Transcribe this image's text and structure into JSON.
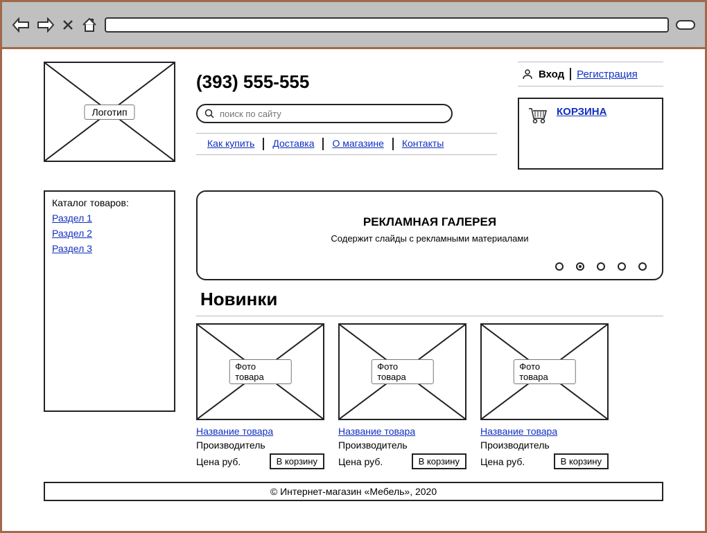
{
  "header": {
    "logo_label": "Логотип",
    "phone": "(393) 555-555",
    "search_placeholder": "поиск по сайту",
    "nav": [
      "Как купить",
      "Доставка",
      "О магазине",
      "Контакты"
    ],
    "login_label": "Вход",
    "register_label": "Регистрация",
    "cart_label": "КОРЗИНА"
  },
  "catalog": {
    "title": "Каталог товаров:",
    "items": [
      "Раздел 1",
      "Раздел 2",
      "Раздел 3"
    ]
  },
  "banner": {
    "title": "РЕКЛАМНАЯ ГАЛЕРЕЯ",
    "subtitle": "Содержит слайды с рекламными материалами",
    "dots": 5,
    "active_dot": 1
  },
  "novinki": {
    "title": "Новинки",
    "products": [
      {
        "photo_label": "Фото товара",
        "name": "Название товара",
        "maker": "Производитель",
        "price": "Цена руб.",
        "btn": "В корзину"
      },
      {
        "photo_label": "Фото товара",
        "name": "Название товара",
        "maker": "Производитель",
        "price": "Цена руб.",
        "btn": "В корзину"
      },
      {
        "photo_label": "Фото товара",
        "name": "Название товара",
        "maker": "Производитель",
        "price": "Цена руб.",
        "btn": "В корзину"
      }
    ]
  },
  "footer": "© Интернет-магазин «Мебель», 2020"
}
